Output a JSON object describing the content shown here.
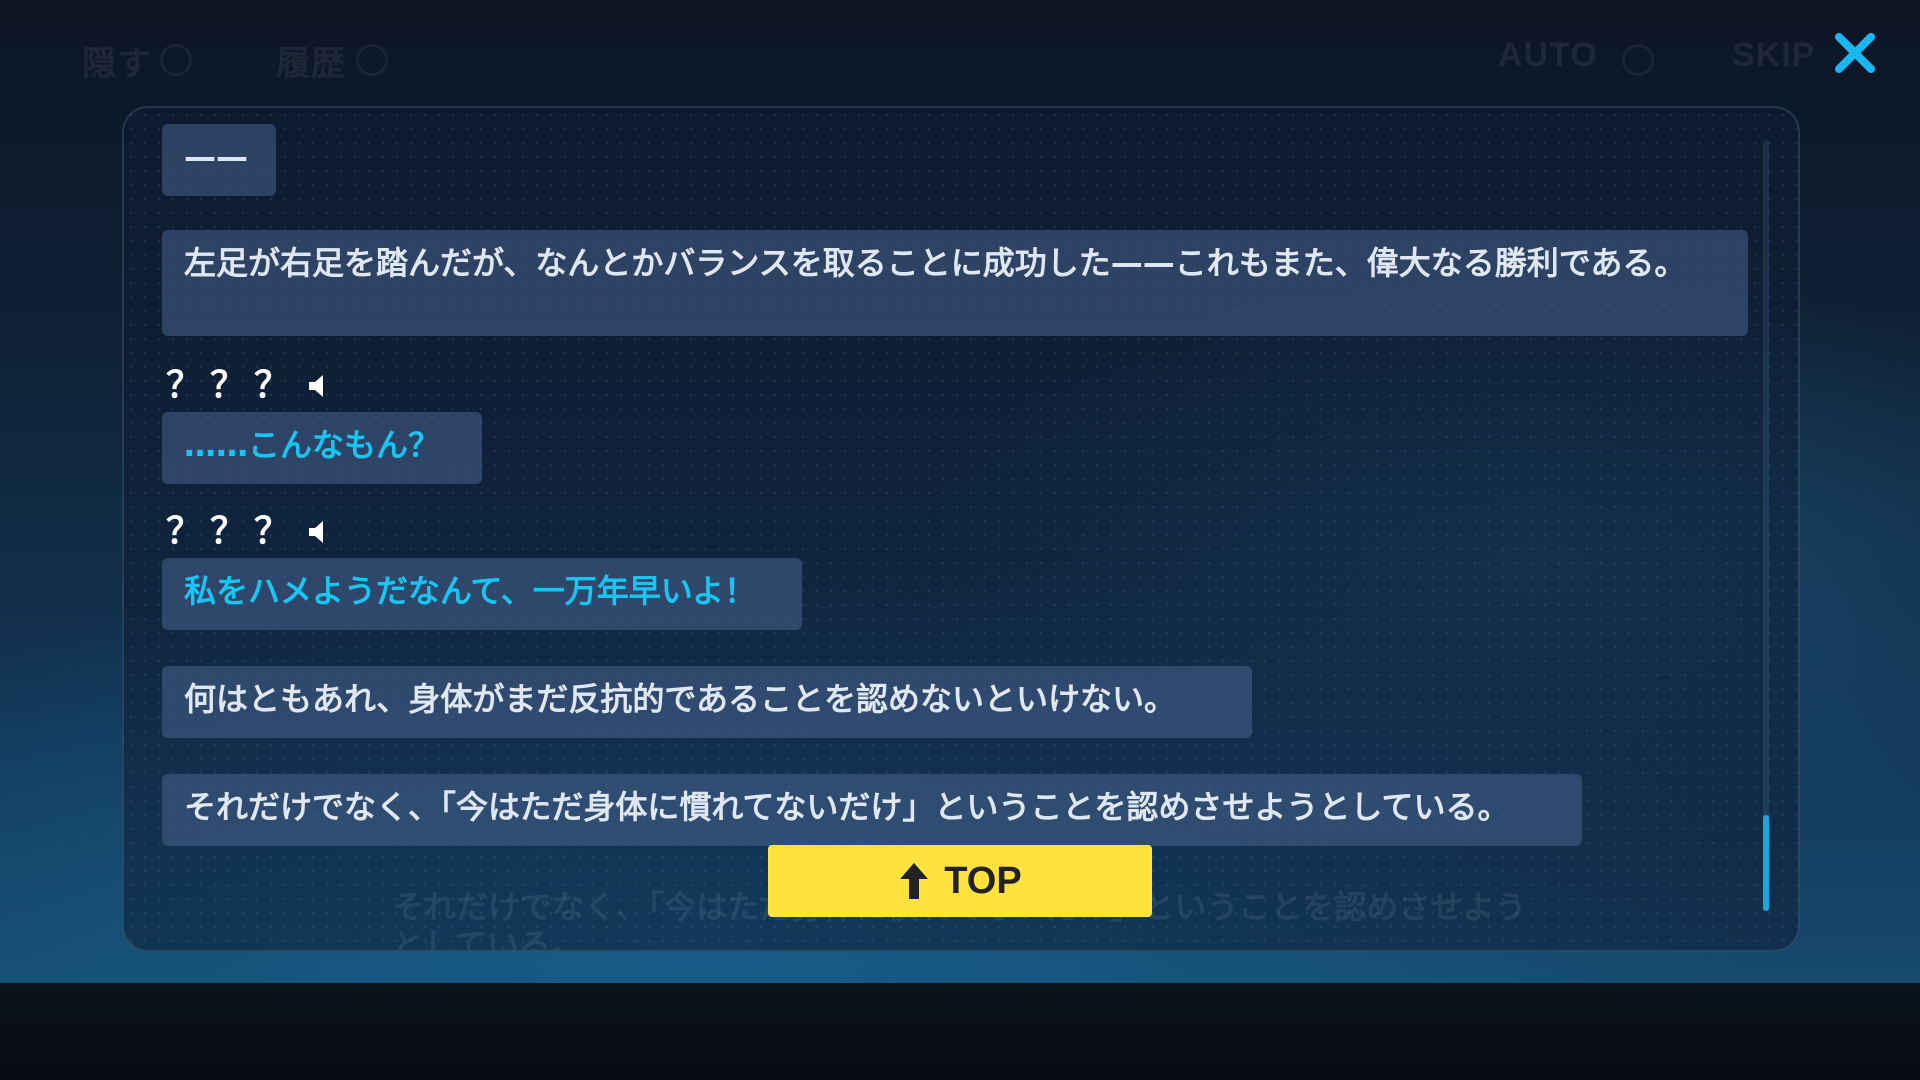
{
  "hud": {
    "hide_label": "隠す",
    "history_label": "履歴",
    "auto_label": "AUTO",
    "skip_label": "SKIP"
  },
  "log": {
    "entries": [
      {
        "speaker": "",
        "text": "——",
        "color": "#dfe7f2"
      },
      {
        "speaker": "",
        "text": "左足が右足を踏んだが、なんとかバランスを取ることに成功した——これもまた、偉大なる勝利である。",
        "color": "#dfe7f2"
      },
      {
        "speaker": "？？？",
        "text": "……こんなもん？",
        "color": "#18c6f5"
      },
      {
        "speaker": "？？？",
        "text": "私をハメようだなんて、一万年早いよ！",
        "color": "#18c6f5"
      },
      {
        "speaker": "",
        "text": "何はともあれ、身体がまだ反抗的であることを認めないといけない。",
        "color": "#dfe7f2"
      },
      {
        "speaker": "",
        "text": "それだけでなく、「今はただ身体に慣れてないだけ」ということを認めさせようとしている。",
        "color": "#dfe7f2"
      }
    ],
    "background_text": "それだけでなく、「今はただ身体に慣れてないだけ」ということを認めさせようとしている。"
  },
  "top_button": {
    "label": "TOP"
  },
  "icons": {
    "close": "close-icon",
    "speaker": "speaker-icon",
    "arrow_up": "arrow-up-icon"
  },
  "colors": {
    "accent": "#1aa7e0",
    "dialogue_cyan": "#18c6f5",
    "top_button": "#ffe23e"
  }
}
